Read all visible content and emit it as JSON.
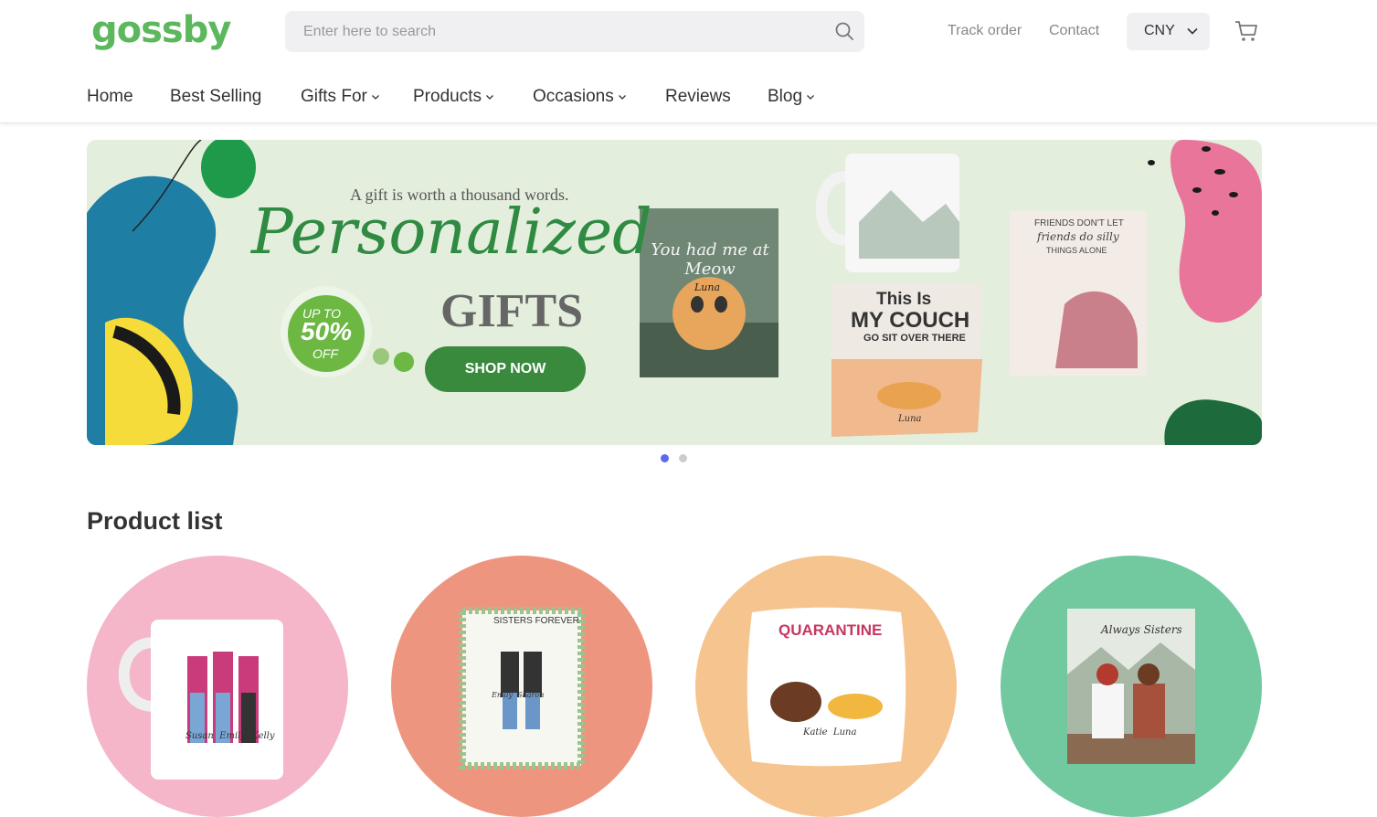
{
  "header": {
    "logo_text": "gossby",
    "search_placeholder": "Enter here to search",
    "track_order": "Track order",
    "contact": "Contact",
    "currency": "CNY"
  },
  "nav": {
    "items": [
      {
        "label": "Home"
      },
      {
        "label": "Best Selling"
      },
      {
        "label": "Gifts For"
      },
      {
        "label": "Products"
      },
      {
        "label": "Occasions"
      },
      {
        "label": "Reviews"
      },
      {
        "label": "Blog"
      }
    ]
  },
  "banner": {
    "tagline": "A gift is worth a thousand words.",
    "headline": "Personalized",
    "subheadline": "GIFTS",
    "promo_line1": "UP TO",
    "promo_line2": "50%",
    "promo_line3": "OFF",
    "cta": "SHOP NOW",
    "canvas1_text": "You had me at Meow",
    "canvas1_name": "Luna",
    "pillow_line1": "This Is",
    "pillow_line2": "MY COUCH",
    "pillow_line3": "GO SIT OVER THERE",
    "pillow_name": "Luna",
    "canvas2_line1": "FRIENDS DON'T LET",
    "canvas2_line2": "friends do silly",
    "canvas2_line3": "THINGS ALONE",
    "slides_total": 2,
    "active_slide": 1
  },
  "colors": {
    "brand": "#5cb85c",
    "cta": "#3a8a3e",
    "dot_active": "#5b6bf0",
    "dot_inactive": "#cccccc"
  },
  "products": {
    "title": "Product list",
    "items": [
      {
        "bg": "#f4b6c8",
        "product": "mug",
        "caption_top": "",
        "names": "Susan  Emily  Kelly"
      },
      {
        "bg": "#ee9580",
        "product": "canvas",
        "caption_top": "SISTERS FOREVER",
        "names": "Emily  Sharon"
      },
      {
        "bg": "#f6c48e",
        "product": "pillow",
        "caption_top": "QUARANTINE",
        "names": "Katie  Luna"
      },
      {
        "bg": "#72c9a0",
        "product": "canvas",
        "caption_top": "Always Sisters",
        "names": ""
      }
    ]
  }
}
